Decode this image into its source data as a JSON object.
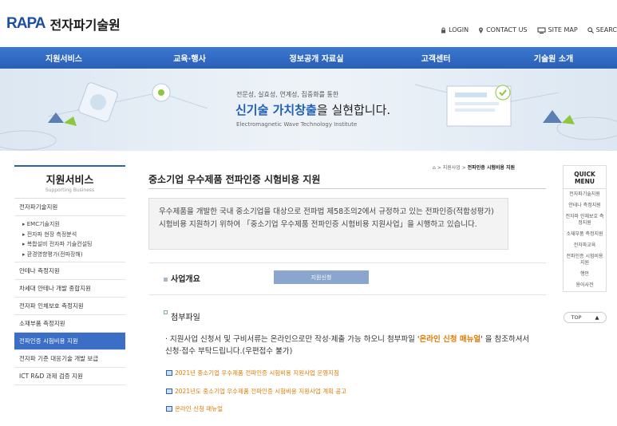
{
  "logo": {
    "mark": "RAPA",
    "name": "전자파기술원"
  },
  "utils": [
    {
      "icon": "lock-icon",
      "label": "LOGIN"
    },
    {
      "icon": "pin-icon",
      "label": "CONTACT US"
    },
    {
      "icon": "monitor-icon",
      "label": "SITE MAP"
    },
    {
      "icon": "search-icon",
      "label": "SEARC"
    }
  ],
  "gnb": [
    "지원서비스",
    "교육·행사",
    "정보공개 자료실",
    "고객센터",
    "기술원 소개"
  ],
  "banner": {
    "sub": "전문성, 실효성, 연계성, 집중화를 통한",
    "main_hl": "신기술 가치창출",
    "main_rest": "을 실현합니다.",
    "eng": "Electromagnetic Wave Technology Institute"
  },
  "sidebar": {
    "title": "지원서비스",
    "subtitle": "Supporting Business",
    "items": [
      {
        "label": "전자파기술지원"
      },
      {
        "label": "안테나 측정지원"
      },
      {
        "label": "차세대 안테나 개발 종합지원"
      },
      {
        "label": "전자파 인체보호 측정지원"
      },
      {
        "label": "소재부품 측정지원"
      },
      {
        "label": "전파인증 시험비용 지원"
      },
      {
        "label": "전자파 기준 대응기술 개발 보급"
      },
      {
        "label": "ICT R&D 과제 검증 지원"
      }
    ],
    "subitems": [
      "▸ EMC기술지원",
      "▸ 전자파 현장 측정분석",
      "▸ 복합설비 전자파 기술컨설팅",
      "▸ 환경영향평가(전파장해)"
    ]
  },
  "content": {
    "title": "중소기업 우수제품 전파인증 시험비용 지원",
    "breadcrumb": {
      "home": "⌂",
      "sep": ">",
      "parent": "지원사업",
      "current": "전파인증 시험비용 지원"
    },
    "intro": "우수제품을 개발한 국내 중소기업을 대상으로 전파법 제58조의2에서 규정하고 있는 전파인증(적합성평가) 시험비용 지원하기 위하여 「중소기업 우수제품 전파인증 시험비용 지원사업」을 시행하고 있습니다.",
    "section1": "사업개요",
    "apply_button": "지원신청",
    "section2": "첨부파일",
    "note_pre": "· 지원사업 신청서 및 구비서류는 온라인으로만 작성·제출 가능 하오니 첨부파일 '",
    "note_hl": "온라인 신청 매뉴얼",
    "note_post": "' 을 참조하셔서 신청·접수 부탁드립니다.(우편접수 불가)",
    "files": [
      "2021년 중소기업 우수제품 전파인증 시험비용 지원사업 운영지침",
      "2021년도 중소기업 우수제품 전파인증 시험비용 지원사업 계획 공고",
      "온라인 신청 매뉴얼"
    ]
  },
  "quick": {
    "title": "QUICK MENU",
    "items": [
      "전자파기술지원",
      "안테나 측정지원",
      "전자파 인체보호 측정지원",
      "소재부품 측정지원",
      "전자파교육",
      "전파인증 시험비용 지원",
      "행안",
      "용어사전"
    ],
    "top": "TOP",
    "top_arrow": "▲"
  }
}
